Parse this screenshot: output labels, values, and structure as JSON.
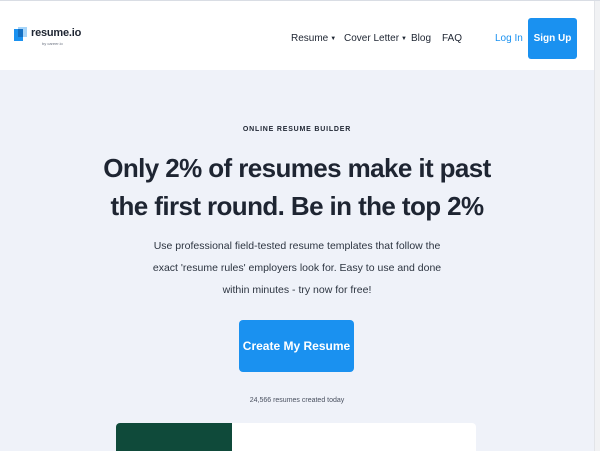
{
  "header": {
    "logo_text": "resume.io",
    "logo_sub": "by career.io",
    "nav": [
      {
        "label": "Resume",
        "has_dropdown": true
      },
      {
        "label": "Cover Letter",
        "has_dropdown": true
      },
      {
        "label": "Blog",
        "has_dropdown": false
      },
      {
        "label": "FAQ",
        "has_dropdown": false
      }
    ],
    "login_label": "Log In",
    "signup_label": "Sign Up"
  },
  "hero": {
    "eyebrow": "ONLINE RESUME BUILDER",
    "headline": "Only 2% of resumes make it past the first round. Be in the top 2%",
    "subtext": "Use professional field-tested resume templates that follow the exact 'resume rules' employers look for. Easy to use and done within minutes - try now for free!",
    "cta_label": "Create My Resume",
    "counter": "24,566 resumes created today"
  },
  "colors": {
    "accent": "#1a91f0",
    "hero_bg": "#eff2f9",
    "preview_accent": "#0f4a3a"
  },
  "icons": {
    "logo": "resume-io-logo-icon",
    "dropdown": "chevron-down-icon"
  }
}
